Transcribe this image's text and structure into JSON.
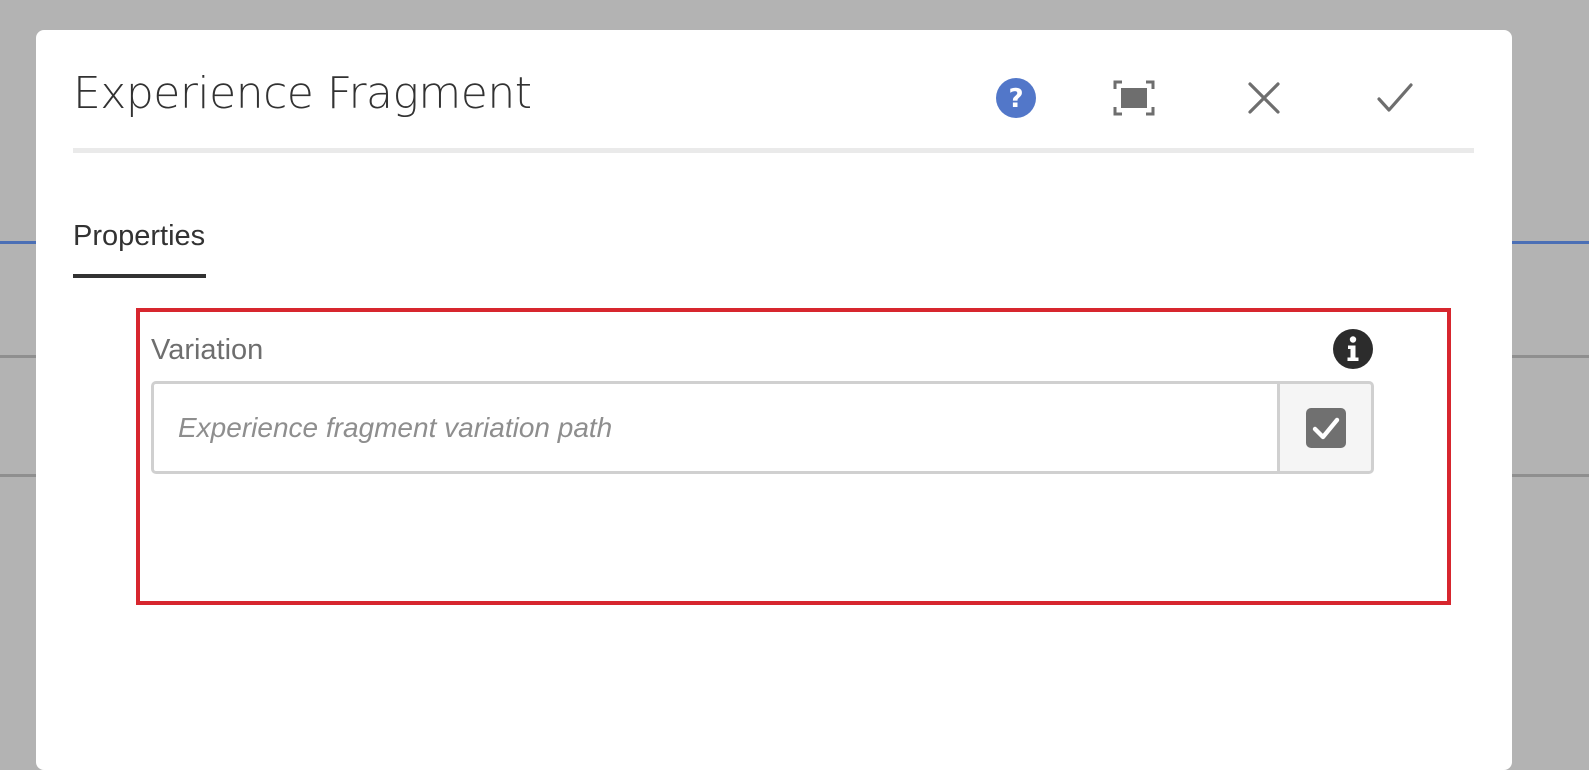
{
  "dialog": {
    "title": "Experience Fragment",
    "actions": {
      "help_icon": "help-icon",
      "fullscreen_icon": "fullscreen-icon",
      "close_icon": "close-icon",
      "done_icon": "checkmark-icon"
    }
  },
  "tabs": [
    {
      "label": "Properties",
      "active": true
    }
  ],
  "fields": {
    "variation": {
      "label": "Variation",
      "value": "",
      "placeholder": "Experience fragment variation path",
      "info_icon": "info-icon",
      "picker_icon": "checkbox-checked-icon"
    }
  },
  "colors": {
    "help_blue": "#5277c9",
    "highlight_red": "#d7262e",
    "backdrop": "#b3b3b3",
    "accent_blue": "#4b6fb5"
  }
}
